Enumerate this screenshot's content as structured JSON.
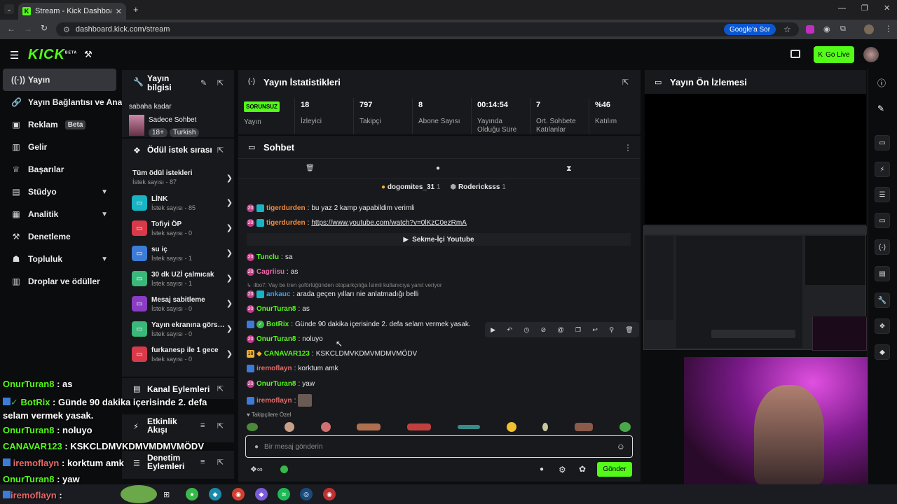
{
  "browser": {
    "tab_title": "Stream - Kick Dashboard",
    "url": "dashboard.kick.com/stream",
    "google_sor": "Google'a Sor"
  },
  "header": {
    "logo": "KICK",
    "logo_sup": "BETA",
    "go_live": "Go Live"
  },
  "sidebar": {
    "items": [
      {
        "label": "Yayın",
        "icon": "signal-icon"
      },
      {
        "label": "Yayın Bağlantısı ve Anahtar",
        "icon": "link-icon"
      },
      {
        "label": "Reklam",
        "icon": "ad-icon",
        "badge": "Beta"
      },
      {
        "label": "Gelir",
        "icon": "revenue-icon"
      },
      {
        "label": "Başarılar",
        "icon": "trophy-icon"
      },
      {
        "label": "Stüdyo",
        "icon": "studio-icon"
      },
      {
        "label": "Analitik",
        "icon": "analytics-icon"
      },
      {
        "label": "Denetleme",
        "icon": "moderation-icon"
      },
      {
        "label": "Topluluk",
        "icon": "community-icon"
      },
      {
        "label": "Droplar ve ödüller",
        "icon": "drops-icon"
      }
    ]
  },
  "stream_info": {
    "title": "Yayın bilgisi",
    "title_line1": "Yayın",
    "title_line2": "bilgisi",
    "subtitle": "sabaha kadar",
    "category": "Sadece Sohbet",
    "tags": [
      "18+",
      "Turkish"
    ]
  },
  "rewards": {
    "title": "Ödül istek sırası",
    "all_label": "Tüm ödül istekleri",
    "all_count": "İstek sayısı - 87",
    "items": [
      {
        "title": "LİNK",
        "count": "İstek sayısı - 85",
        "color": "#18b4c4"
      },
      {
        "title": "Tofiyi ÖP",
        "count": "İstek sayısı - 0",
        "color": "#d93a4a"
      },
      {
        "title": "su iç",
        "count": "İstek sayısı - 1",
        "color": "#3c7cd8"
      },
      {
        "title": "30 dk UZİ çalmıcak",
        "count": "İstek sayısı - 1",
        "color": "#3ab87a"
      },
      {
        "title": "Mesaj sabitleme",
        "count": "İstek sayısı - 0",
        "color": "#8a3cc4"
      },
      {
        "title": "Yayın ekranına görs…",
        "count": "İstek sayısı - 0",
        "color": "#3ab87a"
      },
      {
        "title": "furkanesp ile 1 gece",
        "count": "İstek sayısı - 0",
        "color": "#d93a4a"
      }
    ]
  },
  "channel_actions": {
    "title": "Kanal Eylemleri"
  },
  "activity": {
    "title_line1": "Etkinlik",
    "title_line2": "Akışı"
  },
  "moderation": {
    "title_line1": "Denetim",
    "title_line2": "Eylemleri"
  },
  "stats": {
    "title": "Yayın İstatistikleri",
    "items": [
      {
        "value": "SORUNSUZ",
        "label": "Yayın"
      },
      {
        "value": "18",
        "label": "İzleyici"
      },
      {
        "value": "797",
        "label": "Takipçi"
      },
      {
        "value": "8",
        "label": "Abone Sayısı"
      },
      {
        "value": "00:14:54",
        "label": "Yayında Olduğu Süre"
      },
      {
        "value": "7",
        "label": "Ort. Sohbete Katılanlar"
      },
      {
        "value": "%46",
        "label": "Katılım"
      }
    ]
  },
  "chat": {
    "title": "Sohbet",
    "pinned_users": [
      {
        "name": "dogomites_31",
        "count": "1"
      },
      {
        "name": "Rodericksss",
        "count": "1"
      }
    ],
    "youtube_label": "Sekme-İçi Youtube",
    "reply_note": "ilbo7: Vay be tren şoförlüğünden otoparkçılığa İsimli kullanıcıya yanıt veriyor",
    "messages": [
      {
        "user": "tigerdurden",
        "text": "bu yaz 2 kamp yapabildim verimli",
        "color": "#f08a3c",
        "badge": "20"
      },
      {
        "user": "tigerdurden",
        "text": "https://www.youtube.com/watch?v=0lKzC0ezRmA",
        "color": "#f08a3c",
        "badge": "20"
      },
      {
        "user": "Tunclu",
        "text": "sa",
        "color": "#53fc18",
        "badge": "20"
      },
      {
        "user": "Cagriisu",
        "text": "as",
        "color": "#e86aa8",
        "badge": "20"
      },
      {
        "user": "ankauc",
        "text": "arada geçen yılları nie anlatmadığı belli",
        "color": "#3c9cf0",
        "badge": "20"
      },
      {
        "user": "OnurTuran8",
        "text": "as",
        "color": "#53fc18",
        "badge": "20"
      },
      {
        "user": "BotRix",
        "text": "Günde 90 dakika içerisinde 2. defa selam vermek yasak.",
        "color": "#53fc18",
        "badge": ""
      },
      {
        "user": "OnurTuran8",
        "text": "noluyo",
        "color": "#53fc18",
        "badge": "20"
      },
      {
        "user": "CANAVAR123",
        "text": "KSKCLDMVKDMVMDMVMÖDV",
        "color": "#53fc18",
        "badge": "18"
      },
      {
        "user": "iremoflayn",
        "text": "korktum amk",
        "color": "#e86a6a",
        "badge": ""
      },
      {
        "user": "OnurTuran8",
        "text": "yaw",
        "color": "#53fc18",
        "badge": "20"
      },
      {
        "user": "iremoflayn",
        "text": "",
        "color": "#e86a6a",
        "badge": ""
      }
    ],
    "emote_section": "Takipçilere Özel",
    "input_placeholder": "Bir mesaj gönderin",
    "send": "Gönder"
  },
  "preview": {
    "title": "Yayın Ön İzlemesi"
  },
  "overlay": {
    "lines": [
      {
        "user": "OnurTuran8",
        "text": ": as"
      },
      {
        "user": "BotRix",
        "text": ": Günde 90 dakika içerisinde 2. defa selam vermek yasak."
      },
      {
        "user": "OnurTuran8",
        "text": ": noluyo"
      },
      {
        "user": "CANAVAR123",
        "text": ": KSKCLDMVKDMVMDMVMÖDV"
      },
      {
        "user": "iremoflayn",
        "text": ": korktum amk"
      },
      {
        "user": "OnurTuran8",
        "text": ": yaw"
      },
      {
        "user": "iremoflayn",
        "text": ":"
      }
    ]
  },
  "colors": {
    "accent": "#53fc18",
    "panel": "#18191c",
    "bg": "#0b0c0e"
  }
}
